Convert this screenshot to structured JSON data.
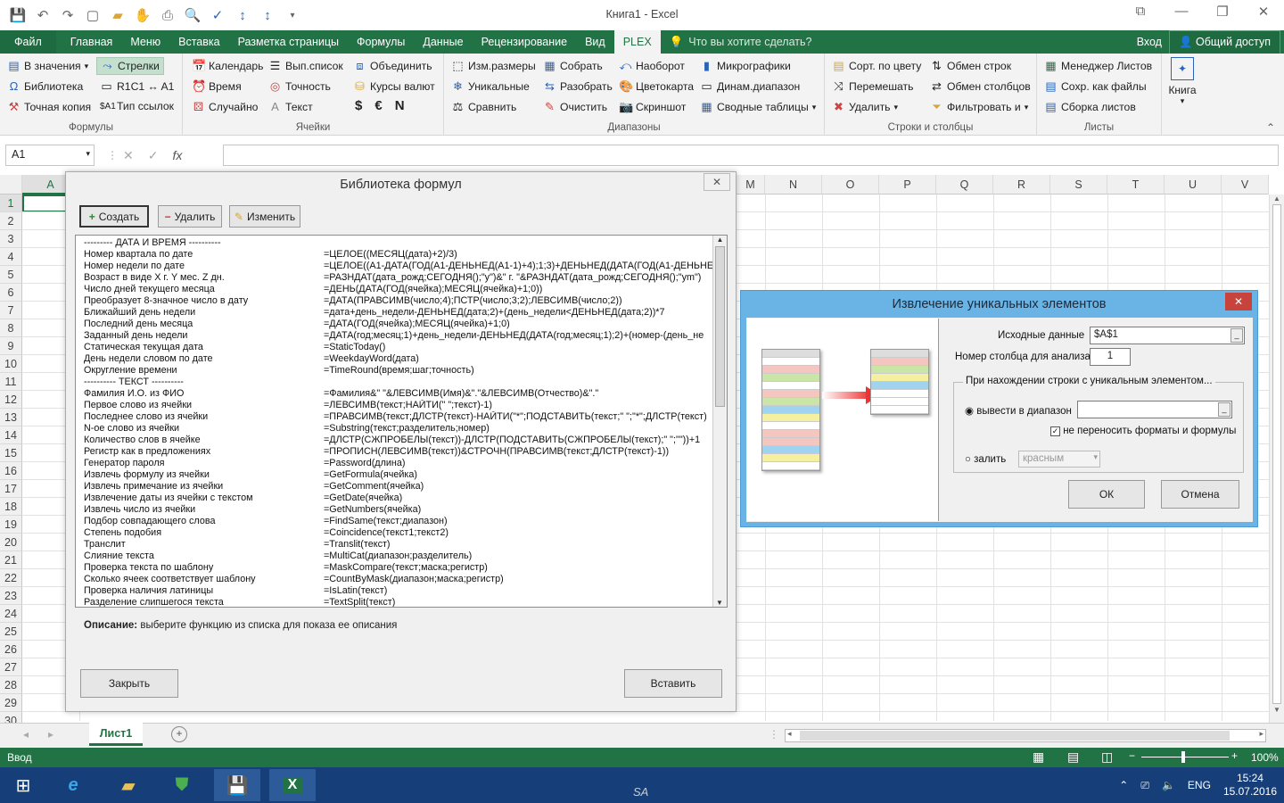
{
  "window": {
    "title": "Книга1 - Excel"
  },
  "tabs": {
    "file": "Файл",
    "home": "Главная",
    "menu": "Меню",
    "insert": "Вставка",
    "layout": "Разметка страницы",
    "formulas": "Формулы",
    "data": "Данные",
    "review": "Рецензирование",
    "view": "Вид",
    "plex": "PLEX",
    "tell": "Что вы хотите сделать?",
    "signin": "Вход",
    "share": "Общий доступ"
  },
  "ribbon": {
    "formulas_group": {
      "label": "Формулы",
      "b1": "В значения",
      "b2": "Стрелки",
      "b3": "Библиотека",
      "b4": "R1C1 ↔ A1",
      "b5": "Точная копия",
      "b6": "Тип ссылок"
    },
    "cells_group": {
      "label": "Ячейки",
      "b1": "Календарь",
      "b2": "Вып.список",
      "b3": "Объединить",
      "b4": "Время",
      "b5": "Точность",
      "b6": "Курсы валют",
      "b7": "Случайно",
      "b8": "Текст",
      "cur1": "$",
      "cur2": "€",
      "cur3": "N"
    },
    "ranges_group": {
      "label": "Диапазоны",
      "b1": "Изм.размеры",
      "b2": "Собрать",
      "b3": "Наоборот",
      "b4": "Микрографики",
      "b5": "Уникальные",
      "b6": "Разобрать",
      "b7": "Цветокарта",
      "b8": "Динам.диапазон",
      "b9": "Сравнить",
      "b10": "Очистить",
      "b11": "Скриншот",
      "b12": "Сводные таблицы"
    },
    "rows_group": {
      "label": "Строки и столбцы",
      "b1": "Сорт. по цвету",
      "b2": "Обмен строк",
      "b3": "Перемешать",
      "b4": "Обмен столбцов",
      "b5": "Удалить",
      "b6": "Фильтровать и"
    },
    "sheets_group": {
      "label": "Листы",
      "b1": "Менеджер Листов",
      "b2": "Сохр. как файлы",
      "b3": "Сборка листов"
    },
    "book": "Книга"
  },
  "formula_bar": {
    "name_box": "A1",
    "fx": "fx"
  },
  "columns": [
    "A",
    "M",
    "N",
    "O",
    "P",
    "Q",
    "R",
    "S",
    "T",
    "U",
    "V"
  ],
  "rows": [
    "1",
    "2",
    "3",
    "4",
    "5",
    "6",
    "7",
    "8",
    "9",
    "10",
    "11",
    "12",
    "13",
    "14",
    "15",
    "16",
    "17",
    "18",
    "19",
    "20",
    "21",
    "22",
    "23",
    "24",
    "25",
    "26",
    "27",
    "28",
    "29",
    "30"
  ],
  "sheet": {
    "tab": "Лист1"
  },
  "status": {
    "mode": "Ввод",
    "zoom": "100%"
  },
  "taskbar": {
    "lang": "ENG",
    "time": "15:24",
    "date": "15.07.2016",
    "sa": "SA"
  },
  "library_dialog": {
    "title": "Библиотека формул",
    "create": "Создать",
    "delete": "Удалить",
    "edit": "Изменить",
    "description_label": "Описание:",
    "description_text": "выберите функцию из списка для показа ее описания",
    "close": "Закрыть",
    "insert": "Вставить",
    "items": [
      {
        "name": "--------- ДАТА И ВРЕМЯ ----------",
        "code": ""
      },
      {
        "name": "Номер квартала по дате",
        "code": "=ЦЕЛОЕ((МЕСЯЦ(дата)+2)/3)"
      },
      {
        "name": "Номер недели по дате",
        "code": "=ЦЕЛОЕ((A1-ДАТА(ГОД(A1-ДЕНЬНЕД(A1-1)+4);1;3)+ДЕНЬНЕД(ДАТА(ГОД(A1-ДЕНЬНЕ"
      },
      {
        "name": "Возраст в виде X г. Y мес. Z дн.",
        "code": "=РАЗНДАТ(дата_рожд;СЕГОДНЯ();\"y\")&\" г. \"&РАЗНДАТ(дата_рожд;СЕГОДНЯ();\"ym\")"
      },
      {
        "name": "Число дней текущего месяца",
        "code": "=ДЕНЬ(ДАТА(ГОД(ячейка);МЕСЯЦ(ячейка)+1;0))"
      },
      {
        "name": "Преобразует 8-значное число в дату",
        "code": "=ДАТА(ПРАВСИМВ(число;4);ПСТР(число;3;2);ЛЕВСИМВ(число;2))"
      },
      {
        "name": "Ближайший день недели",
        "code": "=дата+день_недели-ДЕНЬНЕД(дата;2)+(день_недели<ДЕНЬНЕД(дата;2))*7"
      },
      {
        "name": "Последний день месяца",
        "code": "=ДАТА(ГОД(ячейка);МЕСЯЦ(ячейка)+1;0)"
      },
      {
        "name": "Заданный день недели",
        "code": "=ДАТА(год;месяц;1)+день_недели-ДЕНЬНЕД(ДАТА(год;месяц;1);2)+(номер-(день_не"
      },
      {
        "name": "Статическая текущая дата",
        "code": "=StaticToday()"
      },
      {
        "name": "День недели словом по дате",
        "code": "=WeekdayWord(дата)"
      },
      {
        "name": "Округление времени",
        "code": "=TimeRound(время;шаг;точность)"
      },
      {
        "name": "---------- ТЕКСТ ----------",
        "code": ""
      },
      {
        "name": "Фамилия И.О. из ФИО",
        "code": "=Фамилия&\" \"&ЛЕВСИМВ(Имя)&\".\"&ЛЕВСИМВ(Отчество)&\".\""
      },
      {
        "name": "Первое слово из ячейки",
        "code": "=ЛЕВСИМВ(текст;НАЙТИ(\" \";текст)-1)"
      },
      {
        "name": "Последнее слово из ячейки",
        "code": "=ПРАВСИМВ(текст;ДЛСТР(текст)-НАЙТИ(\"*\";ПОДСТАВИТЬ(текст;\" \";\"*\";ДЛСТР(текст)"
      },
      {
        "name": "N-ое слово из ячейки",
        "code": "=Substring(текст;разделитель;номер)"
      },
      {
        "name": "Количество слов в ячейке",
        "code": "=ДЛСТР(СЖПРОБЕЛЫ(текст))-ДЛСТР(ПОДСТАВИТЬ(СЖПРОБЕЛЫ(текст);\" \";\"\"))+1"
      },
      {
        "name": "Регистр как в предложениях",
        "code": "=ПРОПИСН(ЛЕВСИМВ(текст))&СТРОЧН(ПРАВСИМВ(текст;ДЛСТР(текст)-1))"
      },
      {
        "name": "Генератор пароля",
        "code": "=Password(длина)"
      },
      {
        "name": "Извлечь формулу из ячейки",
        "code": "=GetFormula(ячейка)"
      },
      {
        "name": "Извлечь примечание из ячейки",
        "code": "=GetComment(ячейка)"
      },
      {
        "name": "Извлечение даты из ячейки с текстом",
        "code": "=GetDate(ячейка)"
      },
      {
        "name": "Извлечь число из ячейки",
        "code": "=GetNumbers(ячейка)"
      },
      {
        "name": "Подбор совпадающего слова",
        "code": "=FindSame(текст;диапазон)"
      },
      {
        "name": "Степень подобия",
        "code": "=Coincidence(текст1;текст2)"
      },
      {
        "name": "Транслит",
        "code": "=Translit(текст)"
      },
      {
        "name": "Слияние текста",
        "code": "=MultiCat(диапазон;разделитель)"
      },
      {
        "name": "Проверка текста по шаблону",
        "code": "=MaskCompare(текст;маска;регистр)"
      },
      {
        "name": "Сколько ячеек соответствует шаблону",
        "code": "=CountByMask(диапазон;маска;регистр)"
      },
      {
        "name": "Проверка наличия латиницы",
        "code": "=IsLatin(текст)"
      },
      {
        "name": "Разделение слипшегося текста",
        "code": "=TextSplit(текст)"
      }
    ]
  },
  "unique_dialog": {
    "title": "Извлечение уникальных элементов",
    "source_label": "Исходные данные",
    "source_value": "$A$1",
    "col_label": "Номер столбца для анализа",
    "col_value": "1",
    "group_label": "При нахождении строки с уникальным элементом...",
    "opt1": "вывести в диапазон",
    "check_label": "не переносить форматы и формулы",
    "opt2": "залить",
    "fill_value": "красным",
    "ok": "ОК",
    "cancel": "Отмена"
  }
}
